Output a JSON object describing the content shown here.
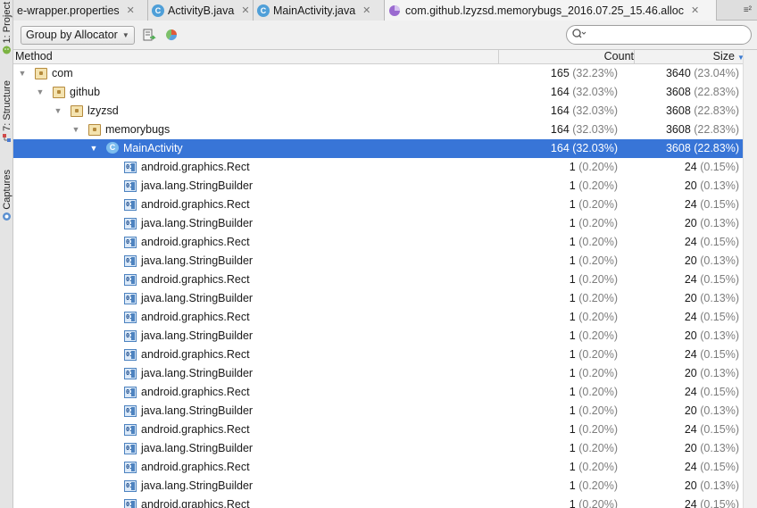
{
  "side_tabs": [
    {
      "label": "1: Project",
      "icon": "android-icon"
    },
    {
      "label": "7: Structure",
      "icon": "structure-icon"
    },
    {
      "label": "Captures",
      "icon": "captures-icon"
    }
  ],
  "tabs": [
    {
      "label": "e-wrapper.properties",
      "close": "✕",
      "icon": ""
    },
    {
      "label": "ActivityB.java",
      "close": "✕",
      "icon": "C"
    },
    {
      "label": "MainActivity.java",
      "close": "✕",
      "icon": "C"
    },
    {
      "label": "com.github.lzyzsd.memorybugs_2016.07.25_15.46.alloc",
      "close": "✕",
      "icon": "alloc-file-icon"
    }
  ],
  "tabs_overflow": "≡²",
  "toolbar": {
    "group_by_label": "Group by Allocator",
    "search_placeholder": ""
  },
  "table": {
    "headers": {
      "method": "Method",
      "count": "Count",
      "size": "Size"
    },
    "rows": [
      {
        "name": "com",
        "count": "165",
        "count_pct": "(32.23%)",
        "size": "3640",
        "size_pct": "(23.04%)"
      },
      {
        "name": "github",
        "count": "164",
        "count_pct": "(32.03%)",
        "size": "3608",
        "size_pct": "(22.83%)"
      },
      {
        "name": "lzyzsd",
        "count": "164",
        "count_pct": "(32.03%)",
        "size": "3608",
        "size_pct": "(22.83%)"
      },
      {
        "name": "memorybugs",
        "count": "164",
        "count_pct": "(32.03%)",
        "size": "3608",
        "size_pct": "(22.83%)"
      },
      {
        "name": "MainActivity",
        "count": "164",
        "count_pct": "(32.03%)",
        "size": "3608",
        "size_pct": "(22.83%)"
      },
      {
        "name": "android.graphics.Rect",
        "count": "1",
        "count_pct": "(0.20%)",
        "size": "24",
        "size_pct": "(0.15%)"
      },
      {
        "name": "java.lang.StringBuilder",
        "count": "1",
        "count_pct": "(0.20%)",
        "size": "20",
        "size_pct": "(0.13%)"
      },
      {
        "name": "android.graphics.Rect",
        "count": "1",
        "count_pct": "(0.20%)",
        "size": "24",
        "size_pct": "(0.15%)"
      },
      {
        "name": "java.lang.StringBuilder",
        "count": "1",
        "count_pct": "(0.20%)",
        "size": "20",
        "size_pct": "(0.13%)"
      },
      {
        "name": "android.graphics.Rect",
        "count": "1",
        "count_pct": "(0.20%)",
        "size": "24",
        "size_pct": "(0.15%)"
      },
      {
        "name": "java.lang.StringBuilder",
        "count": "1",
        "count_pct": "(0.20%)",
        "size": "20",
        "size_pct": "(0.13%)"
      },
      {
        "name": "android.graphics.Rect",
        "count": "1",
        "count_pct": "(0.20%)",
        "size": "24",
        "size_pct": "(0.15%)"
      },
      {
        "name": "java.lang.StringBuilder",
        "count": "1",
        "count_pct": "(0.20%)",
        "size": "20",
        "size_pct": "(0.13%)"
      },
      {
        "name": "android.graphics.Rect",
        "count": "1",
        "count_pct": "(0.20%)",
        "size": "24",
        "size_pct": "(0.15%)"
      },
      {
        "name": "java.lang.StringBuilder",
        "count": "1",
        "count_pct": "(0.20%)",
        "size": "20",
        "size_pct": "(0.13%)"
      },
      {
        "name": "android.graphics.Rect",
        "count": "1",
        "count_pct": "(0.20%)",
        "size": "24",
        "size_pct": "(0.15%)"
      },
      {
        "name": "java.lang.StringBuilder",
        "count": "1",
        "count_pct": "(0.20%)",
        "size": "20",
        "size_pct": "(0.13%)"
      },
      {
        "name": "android.graphics.Rect",
        "count": "1",
        "count_pct": "(0.20%)",
        "size": "24",
        "size_pct": "(0.15%)"
      },
      {
        "name": "java.lang.StringBuilder",
        "count": "1",
        "count_pct": "(0.20%)",
        "size": "20",
        "size_pct": "(0.13%)"
      },
      {
        "name": "android.graphics.Rect",
        "count": "1",
        "count_pct": "(0.20%)",
        "size": "24",
        "size_pct": "(0.15%)"
      },
      {
        "name": "java.lang.StringBuilder",
        "count": "1",
        "count_pct": "(0.20%)",
        "size": "20",
        "size_pct": "(0.13%)"
      },
      {
        "name": "android.graphics.Rect",
        "count": "1",
        "count_pct": "(0.20%)",
        "size": "24",
        "size_pct": "(0.15%)"
      },
      {
        "name": "java.lang.StringBuilder",
        "count": "1",
        "count_pct": "(0.20%)",
        "size": "20",
        "size_pct": "(0.13%)"
      },
      {
        "name": "android.graphics.Rect",
        "count": "1",
        "count_pct": "(0.20%)",
        "size": "24",
        "size_pct": "(0.15%)"
      }
    ]
  },
  "colors": {
    "selection": "#3875d7",
    "percent_text": "#7d7d7d",
    "class_icon": "#4f9fd8"
  }
}
